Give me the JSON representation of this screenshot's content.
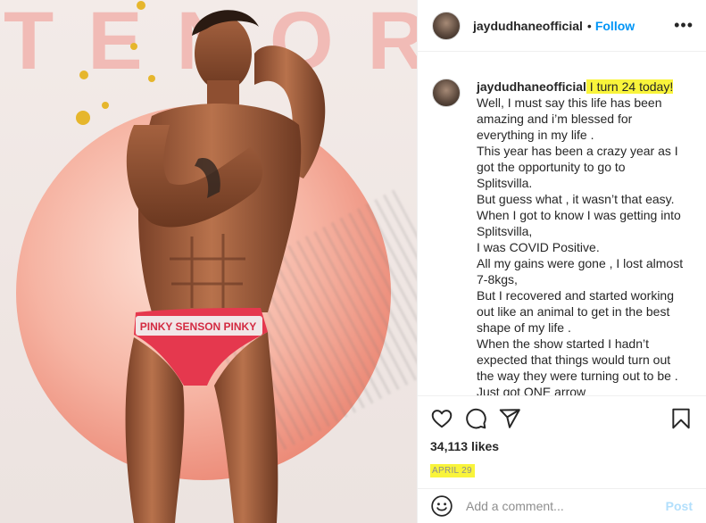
{
  "media": {
    "brand_text": "TENOR",
    "waistband_text": "PINKY SENSON PINKY",
    "colors": {
      "circle": "#ec8b78",
      "brand": "#f1b3ae",
      "background": "#efe6e3"
    }
  },
  "header": {
    "username": "jaydudhaneofficial",
    "separator": "•",
    "follow_label": "Follow",
    "more_icon": "more-options-icon",
    "more_label": "•••"
  },
  "caption": {
    "username": "jaydudhaneofficial",
    "highlight": " I turn 24 today!",
    "lines": [
      "Well, I must say this life has been",
      "amazing and i’m blessed for",
      "everything in my life .",
      "This year has been a crazy year as I",
      "got the opportunity to go to",
      "Splitsvilla.",
      "But guess what , it wasn’t that easy.",
      "When I got to know I was getting into",
      "Splitsvilla,",
      "I was COVID Positive.",
      "All my gains were gone , I lost almost",
      "7-8kgs,",
      "But I recovered and started working",
      "out like an animal to get in the best",
      "shape of my life .",
      "When the show started I hadn’t",
      "expected that things would turn out",
      "the way they were turning out to be .",
      "Just got ONE arrow"
    ]
  },
  "actions": {
    "icons": [
      "heart-icon",
      "comment-icon",
      "share-icon",
      "bookmark-icon"
    ],
    "likes": "34,113 likes",
    "date": "APRIL 29"
  },
  "comment": {
    "placeholder": "Add a comment...",
    "post_label": "Post",
    "emoji_icon": "emoji-icon"
  },
  "colors": {
    "accent": "#0095f6",
    "post_disabled": "#b2dffc",
    "highlight": "#f9f43b"
  }
}
